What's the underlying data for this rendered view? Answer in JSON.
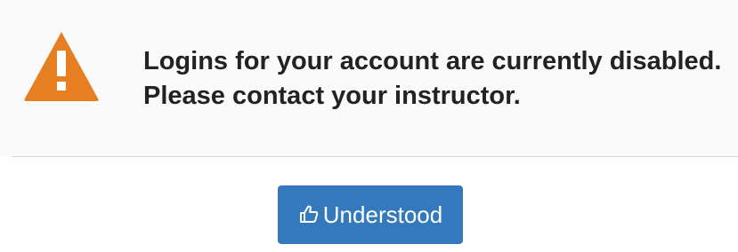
{
  "dialog": {
    "message_lines": [
      "Logins for your account are currently disabled.",
      "Please contact your instructor."
    ],
    "icon": "warning-icon",
    "accent_color": "#e67e22"
  },
  "actions": {
    "understood_label": "Understood",
    "understood_icon": "thumbs-up-icon",
    "button_color": "#3379bb"
  }
}
